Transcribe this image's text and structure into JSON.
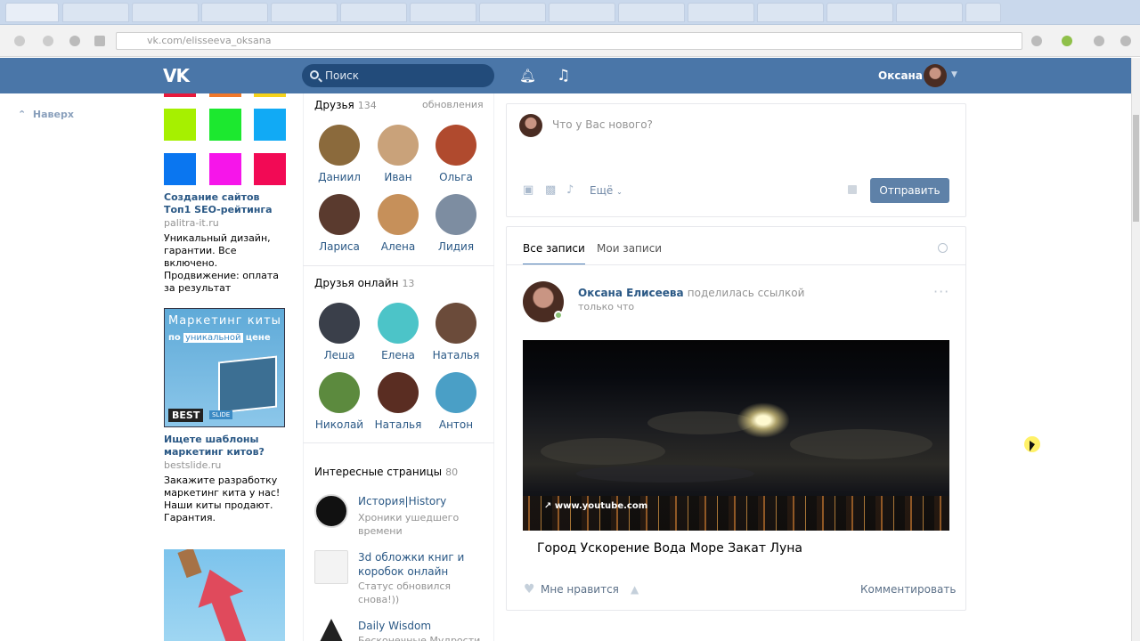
{
  "browser": {
    "url": "vk.com/elisseeva_oksana"
  },
  "header": {
    "logo": "VK",
    "search_placeholder": "Поиск",
    "user_name": "Оксана"
  },
  "left": {
    "back_label": "Наверх",
    "ad1": {
      "title": "Создание сайтов Топ1 SEO-рейтинга",
      "domain": "palitra-it.ru",
      "text": "Уникальный дизайн, гарантии. Все включено. Продвижение: оплата за результат",
      "colors": [
        "#a6f000",
        "#1ce82f",
        "#11aaf5",
        "#0a76f0",
        "#f615ea",
        "#f20a55"
      ]
    },
    "ad2": {
      "banner_line1": "Маркетинг киты",
      "banner_line2a": "по",
      "banner_line2b": "уникальной",
      "banner_line2c": "цене",
      "banner_brand": "BEST",
      "banner_brand2": "SLIDE",
      "title": "Ищете шаблоны маркетинг китов?",
      "domain": "bestslide.ru",
      "text": "Закажите разработку маркетинг кита у нас! Наши киты продают. Гарантия."
    }
  },
  "middle": {
    "friends": {
      "title": "Друзья",
      "count": "134",
      "updates_link": "обновления",
      "items": [
        {
          "name": "Даниил",
          "color": "#8b6a3c"
        },
        {
          "name": "Иван",
          "color": "#c9a27a"
        },
        {
          "name": "Ольга",
          "color": "#b04a2e"
        },
        {
          "name": "Лариса",
          "color": "#5a3a2e"
        },
        {
          "name": "Алена",
          "color": "#c6905a"
        },
        {
          "name": "Лидия",
          "color": "#7d8da1"
        }
      ]
    },
    "online": {
      "title": "Друзья онлайн",
      "count": "13",
      "items": [
        {
          "name": "Леша",
          "color": "#3a3f4a"
        },
        {
          "name": "Елена",
          "color": "#4cc4c8"
        },
        {
          "name": "Наталья",
          "color": "#6b4b3a"
        },
        {
          "name": "Николай",
          "color": "#5c8a3e"
        },
        {
          "name": "Наталья",
          "color": "#5a2d22"
        },
        {
          "name": "Антон",
          "color": "#4a9fc6"
        }
      ]
    },
    "pages": {
      "title": "Интересные страницы",
      "count": "80",
      "items": [
        {
          "name": "История|History",
          "status": "Хроники ушедшего времени",
          "logo": "#111111"
        },
        {
          "name": "3d обложки книг и коробок онлайн",
          "status": "Статус обновился снова!))",
          "logo": "#f3f3f3"
        },
        {
          "name": "Daily Wisdom",
          "status": "Бесконечные Мудрости",
          "logo": "#222222"
        }
      ]
    }
  },
  "feed": {
    "composer": {
      "placeholder": "Что у Вас нового?",
      "more_label": "Ещё",
      "send_label": "Отправить"
    },
    "tabs": [
      {
        "label": "Все записи"
      },
      {
        "label": "Мои записи"
      }
    ],
    "post": {
      "author": "Оксана Елисеева",
      "action": "поделилась ссылкой",
      "time": "только что",
      "video_source": "www.youtube.com",
      "video_title": "Город Ускорение Вода Море Закат Луна",
      "like_label": "Мне нравится",
      "comment_label": "Комментировать"
    }
  }
}
